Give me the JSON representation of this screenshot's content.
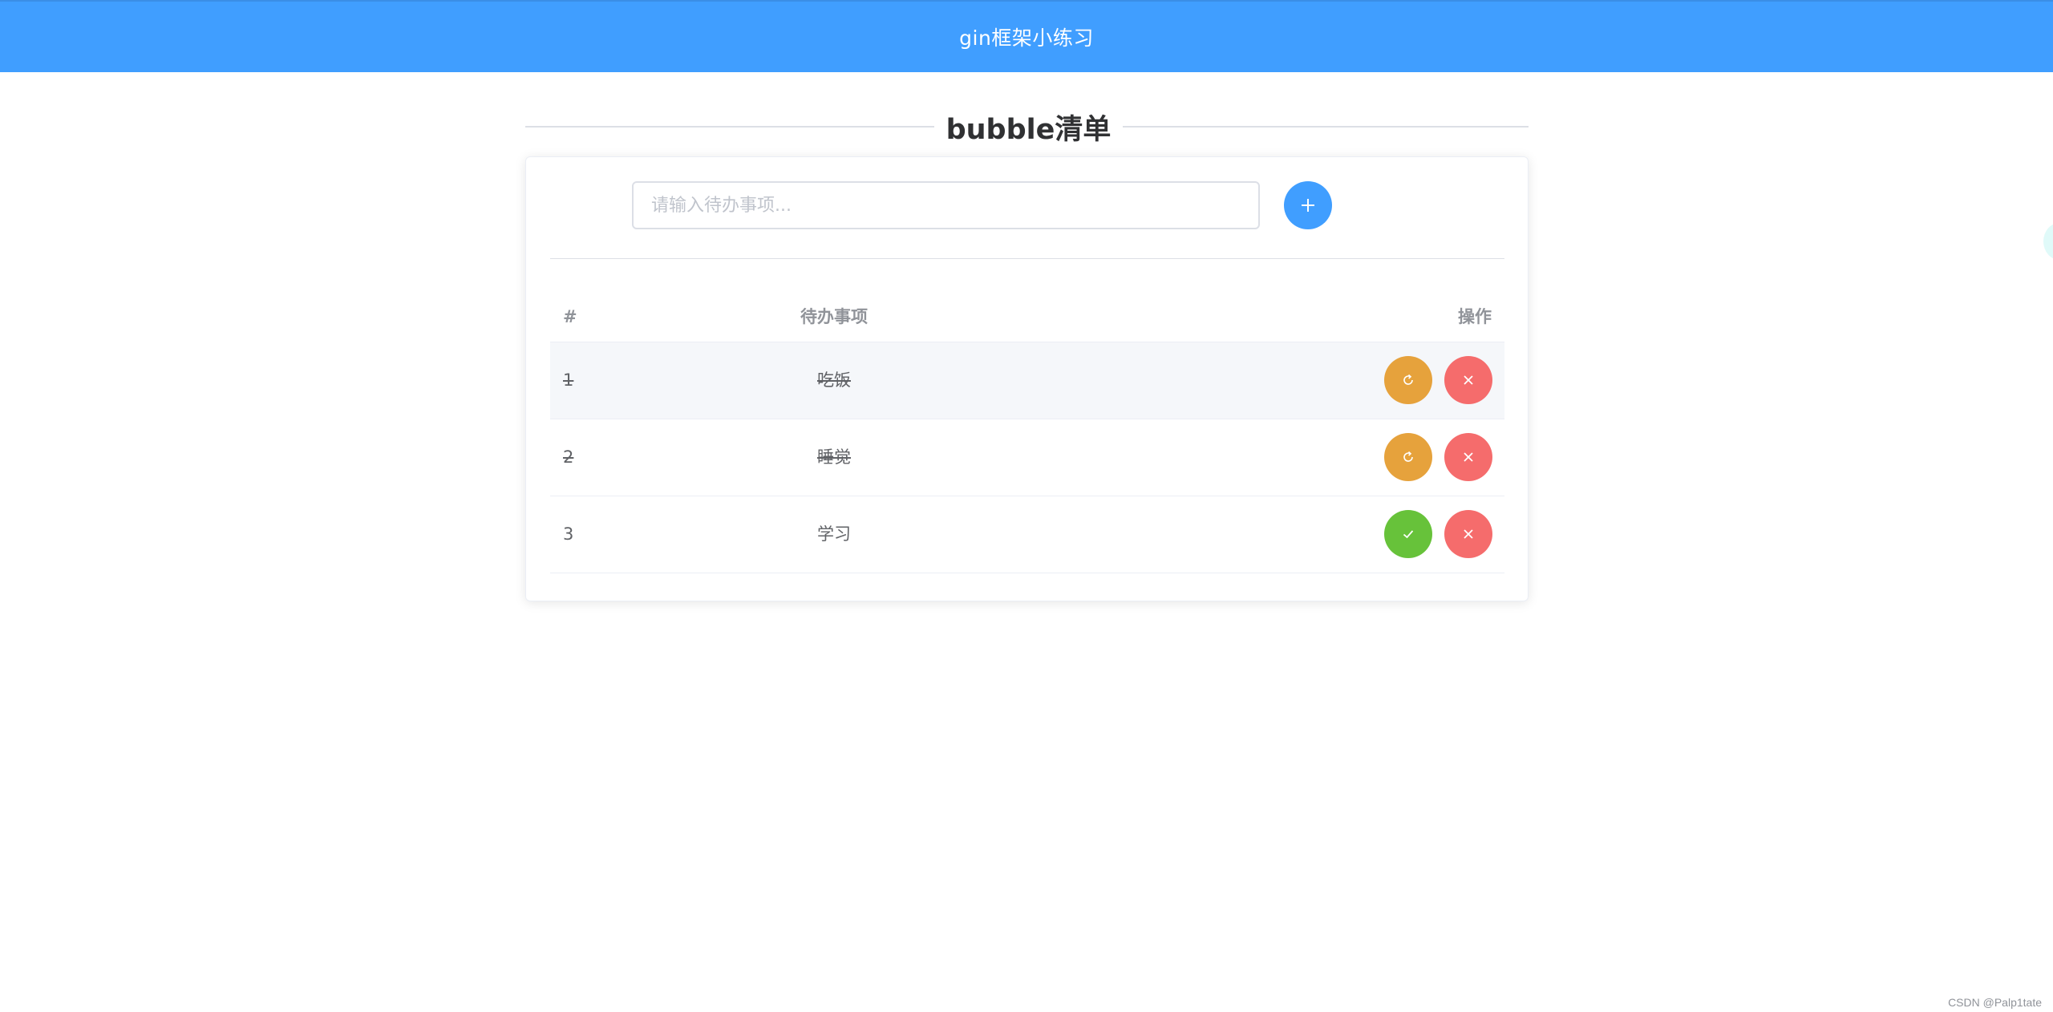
{
  "header": {
    "title": "gin框架小练习"
  },
  "heading": "bubble清单",
  "input": {
    "placeholder": "请输入待办事项...",
    "value": ""
  },
  "table": {
    "columns": {
      "number": "#",
      "item": "待办事项",
      "actions": "操作"
    },
    "rows": [
      {
        "id": "1",
        "title": "吃饭",
        "done": true
      },
      {
        "id": "2",
        "title": "睡觉",
        "done": true
      },
      {
        "id": "3",
        "title": "学习",
        "done": false
      }
    ]
  },
  "icons": {
    "add": "plus-icon",
    "undo": "refresh-icon",
    "complete": "check-icon",
    "delete": "close-icon"
  },
  "colors": {
    "primary": "#409eff",
    "warning": "#e6a23c",
    "success": "#67c23a",
    "danger": "#f56c6c"
  },
  "watermark": "CSDN @Palp1tate"
}
